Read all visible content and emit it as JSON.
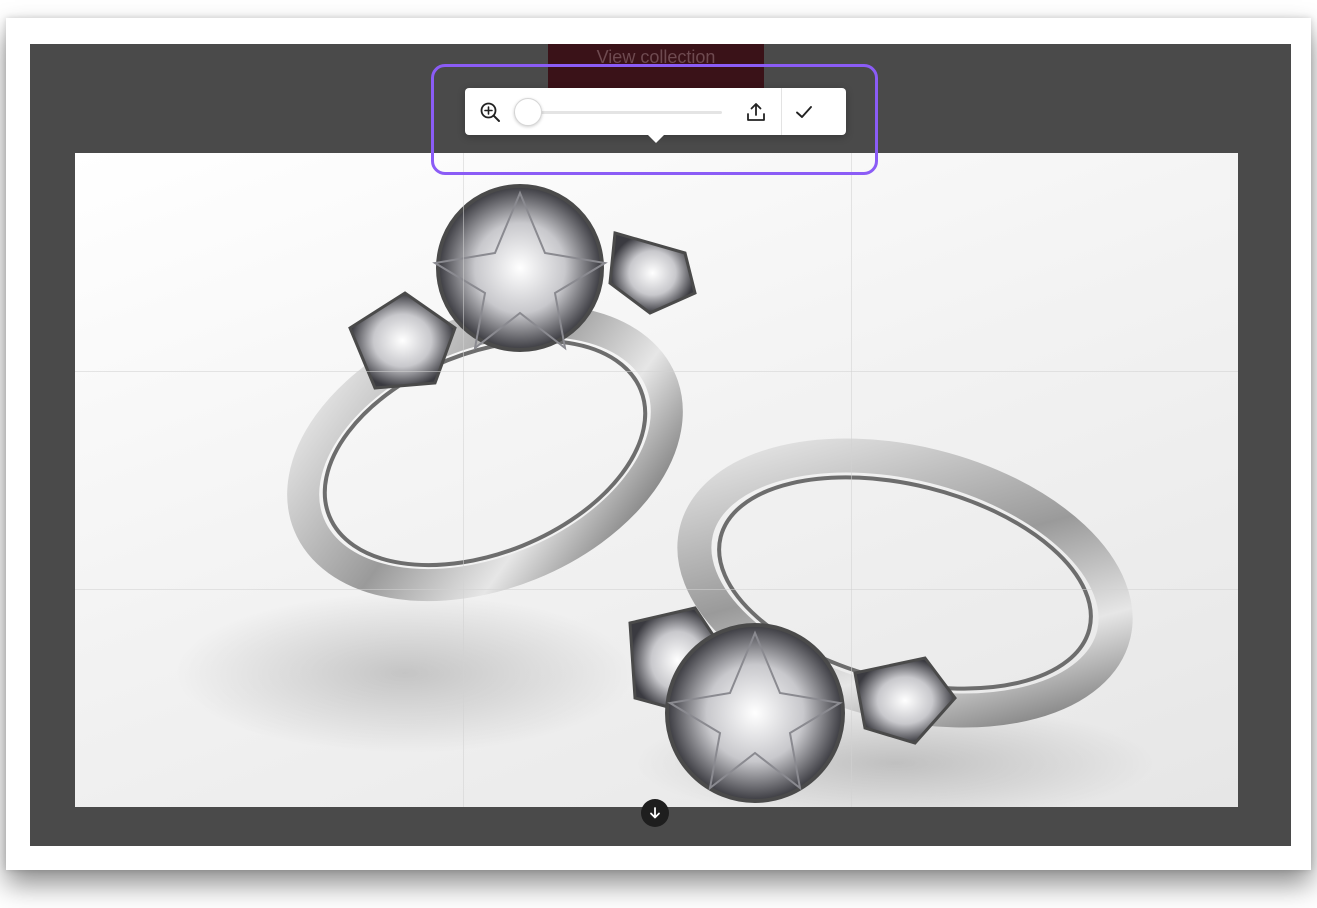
{
  "header": {
    "view_collection_label": "View collection"
  },
  "toolbar": {
    "zoom_icon": "zoom-in-icon",
    "zoom_level": 0,
    "upload_icon": "upload-icon",
    "confirm_icon": "checkmark-icon"
  },
  "canvas": {
    "image_subject": "two-diamond-engagement-rings",
    "bottom_handle_icon": "arrow-down-icon"
  },
  "colors": {
    "highlight": "#8b5cf6",
    "backdrop": "#4a4a4a",
    "button_bg": "#3a1218"
  }
}
